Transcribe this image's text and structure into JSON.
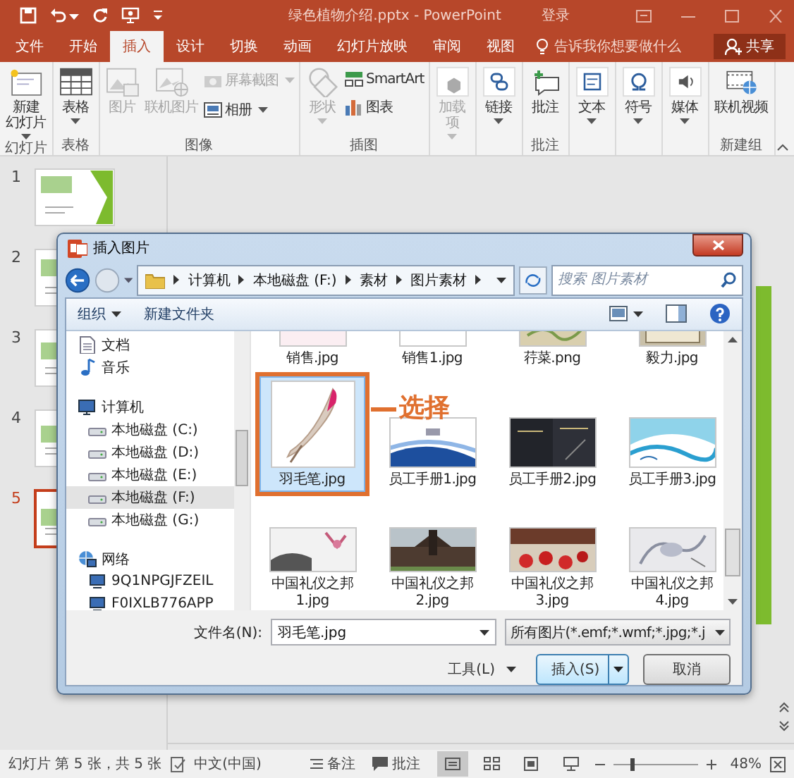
{
  "window": {
    "title": "绿色植物介绍.pptx - PowerPoint",
    "account": "登录"
  },
  "tabs": [
    {
      "label": "文件",
      "selected": false
    },
    {
      "label": "开始",
      "selected": false
    },
    {
      "label": "插入",
      "selected": true
    },
    {
      "label": "设计",
      "selected": false
    },
    {
      "label": "切换",
      "selected": false
    },
    {
      "label": "动画",
      "selected": false
    },
    {
      "label": "幻灯片放映",
      "selected": false
    },
    {
      "label": "审阅",
      "selected": false
    },
    {
      "label": "视图",
      "selected": false
    }
  ],
  "tell_me": {
    "placeholder": "告诉我你想要做什么"
  },
  "share": "共享",
  "ribbon": [
    {
      "label": "幻灯片",
      "items": [
        {
          "kind": "large",
          "lines": [
            "新建",
            "幻灯片"
          ],
          "menu": true,
          "disabled": false
        }
      ]
    },
    {
      "label": "表格",
      "items": [
        {
          "kind": "large",
          "lines": [
            "表格"
          ],
          "menu": true,
          "disabled": false
        }
      ]
    },
    {
      "label": "图像",
      "items": [
        {
          "kind": "large",
          "lines": [
            "图片"
          ],
          "menu": false,
          "disabled": true
        },
        {
          "kind": "large",
          "lines": [
            "联机图片"
          ],
          "menu": false,
          "disabled": true
        },
        {
          "kind": "small",
          "lines": [
            "屏幕截图"
          ],
          "menu": true,
          "disabled": true
        },
        {
          "kind": "small",
          "lines": [
            "相册"
          ],
          "menu": true,
          "disabled": false
        }
      ]
    },
    {
      "label": "插图",
      "items": [
        {
          "kind": "large",
          "lines": [
            "形状"
          ],
          "menu": true,
          "disabled": true
        },
        {
          "kind": "small",
          "lines": [
            "SmartArt"
          ],
          "menu": false,
          "disabled": false
        },
        {
          "kind": "small",
          "lines": [
            "图表"
          ],
          "menu": false,
          "disabled": false
        }
      ]
    },
    {
      "items": [
        {
          "kind": "large",
          "lines": [
            "加载",
            "项"
          ],
          "menu": true,
          "disabled": true
        }
      ]
    },
    {
      "items": [
        {
          "kind": "large",
          "lines": [
            "链接"
          ],
          "menu": true,
          "disabled": false
        }
      ]
    },
    {
      "label": "批注",
      "items": [
        {
          "kind": "large",
          "lines": [
            "批注"
          ],
          "menu": false,
          "disabled": false
        }
      ]
    },
    {
      "items": [
        {
          "kind": "large",
          "lines": [
            "文本"
          ],
          "menu": true,
          "disabled": false
        }
      ]
    },
    {
      "items": [
        {
          "kind": "large",
          "lines": [
            "符号"
          ],
          "menu": true,
          "disabled": false
        }
      ]
    },
    {
      "items": [
        {
          "kind": "large",
          "lines": [
            "媒体"
          ],
          "menu": true,
          "disabled": false
        }
      ]
    },
    {
      "label": "新建组",
      "items": [
        {
          "kind": "large",
          "lines": [
            "联机视频"
          ],
          "menu": false,
          "disabled": false
        }
      ]
    }
  ],
  "slides": [
    {
      "number": "1",
      "selected": false
    },
    {
      "number": "2",
      "selected": false
    },
    {
      "number": "3",
      "selected": false
    },
    {
      "number": "4",
      "selected": false
    },
    {
      "number": "5",
      "selected": true
    }
  ],
  "dialog": {
    "title": "插入图片",
    "breadcrumb": [
      "计算机",
      "本地磁盘 (F:)",
      "素材",
      "图片素材"
    ],
    "search": {
      "placeholder": "搜索 图片素材"
    },
    "toolbar": [
      {
        "label": "组织",
        "menu": true
      },
      {
        "label": "新建文件夹",
        "menu": false
      }
    ],
    "nav": [
      {
        "label": "文档",
        "kind": "library",
        "selected": false
      },
      {
        "label": "音乐",
        "kind": "music",
        "selected": false
      },
      {
        "label": "计算机",
        "kind": "computer",
        "selected": false,
        "children": [
          {
            "label": "本地磁盘 (C:)",
            "kind": "drive",
            "selected": false
          },
          {
            "label": "本地磁盘 (D:)",
            "kind": "drive",
            "selected": false
          },
          {
            "label": "本地磁盘 (E:)",
            "kind": "drive",
            "selected": false
          },
          {
            "label": "本地磁盘 (F:)",
            "kind": "drive",
            "selected": true
          },
          {
            "label": "本地磁盘 (G:)",
            "kind": "drive",
            "selected": false
          }
        ]
      },
      {
        "label": "网络",
        "kind": "network",
        "selected": false,
        "children": [
          {
            "label": "9Q1NPGJFZEIL",
            "kind": "host",
            "selected": false
          },
          {
            "label": "F0IXLB776APP",
            "kind": "host",
            "selected": false
          }
        ]
      }
    ],
    "files": [
      {
        "name": "销售.jpg",
        "selected": false
      },
      {
        "name": "销售1.jpg",
        "selected": false
      },
      {
        "name": "荇菜.png",
        "selected": false
      },
      {
        "name": "毅力.jpg",
        "selected": false
      },
      {
        "name": "羽毛笔.jpg",
        "selected": true
      },
      {
        "name": "员工手册1.jpg",
        "selected": false
      },
      {
        "name": "员工手册2.jpg",
        "selected": false
      },
      {
        "name": "员工手册3.jpg",
        "selected": false
      },
      {
        "name": "中国礼仪之邦1.jpg",
        "selected": false
      },
      {
        "name": "中国礼仪之邦2.jpg",
        "selected": false
      },
      {
        "name": "中国礼仪之邦3.jpg",
        "selected": false
      },
      {
        "name": "中国礼仪之邦4.jpg",
        "selected": false
      }
    ],
    "callout": {
      "text": "选择"
    },
    "filename": {
      "label": "文件名(N):",
      "value": "羽毛笔.jpg"
    },
    "filter": "所有图片(*.emf;*.wmf;*.jpg;*.j",
    "tools": "工具(L)",
    "insert": "插入(S)",
    "cancel": "取消"
  },
  "status": {
    "slide_info": "幻灯片 第 5 张，共 5 张",
    "language": "中文(中国)",
    "notes": "备注",
    "comments": "批注",
    "views": [
      {
        "selected": true
      },
      {
        "selected": false
      },
      {
        "selected": false
      },
      {
        "selected": false
      }
    ],
    "zoom": {
      "level": 0.22,
      "reading": "48%"
    }
  }
}
